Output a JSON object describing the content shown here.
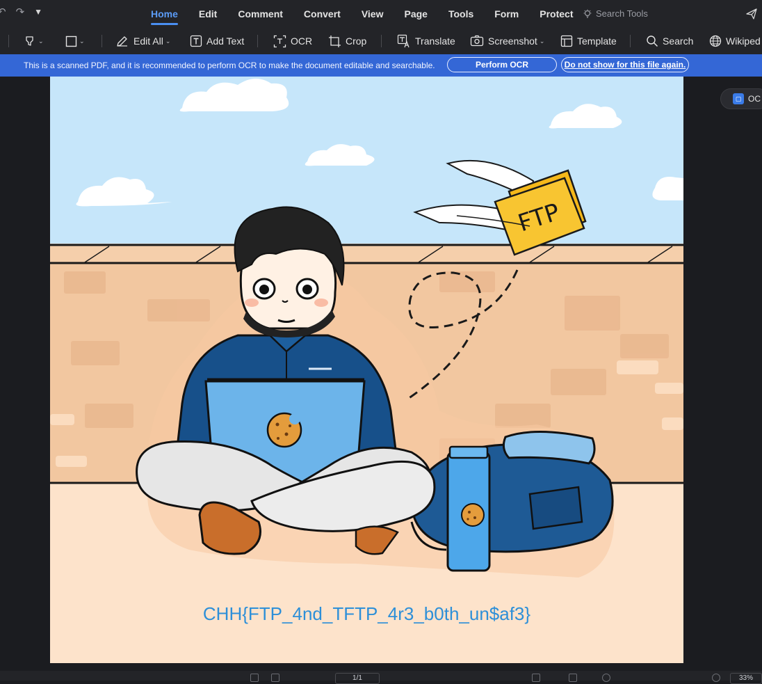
{
  "menu": {
    "tabs": [
      {
        "label": "Home",
        "active": true
      },
      {
        "label": "Edit"
      },
      {
        "label": "Comment"
      },
      {
        "label": "Convert"
      },
      {
        "label": "View"
      },
      {
        "label": "Page"
      },
      {
        "label": "Tools"
      },
      {
        "label": "Form"
      },
      {
        "label": "Protect"
      }
    ],
    "search_tools": "Search Tools"
  },
  "toolbar": {
    "edit_all": "Edit All",
    "add_text": "Add Text",
    "ocr": "OCR",
    "crop": "Crop",
    "translate": "Translate",
    "screenshot": "Screenshot",
    "template": "Template",
    "search": "Search",
    "wikipedia": "Wikiped"
  },
  "banner": {
    "message": "This is a scanned PDF, and it is recommended to perform OCR to make the document editable and searchable.",
    "perform_ocr": "Perform OCR",
    "dismiss": "Do not show for this file again."
  },
  "document": {
    "folder_label": "FTP",
    "flag_text": "CHH{FTP_4nd_TFTP_4r3_b0th_un$af3}"
  },
  "side_panel": {
    "ocr_chip": "OC"
  },
  "status": {
    "page_indicator": "1/1",
    "zoom": "33%"
  },
  "colors": {
    "accent": "#4a8ff2",
    "banner": "#3467d6",
    "sky": "#c6e6fa",
    "wall": "#f2c7a0",
    "ground": "#fde3cb",
    "shirt": "#17508a",
    "laptop": "#6cb4ea",
    "folder": "#f5b81a",
    "flag_text": "#2d8fd8"
  }
}
